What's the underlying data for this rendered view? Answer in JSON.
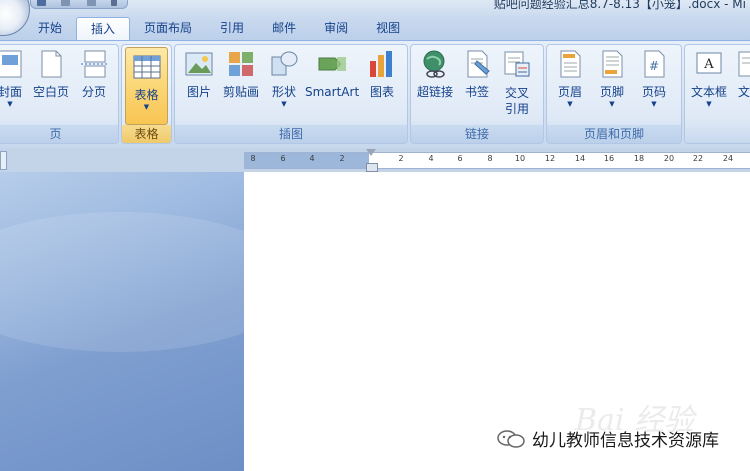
{
  "window": {
    "title": "贴吧问题经验汇总8.7-8.13【小笼】.docx - Mi"
  },
  "tabs": [
    {
      "label": "开始"
    },
    {
      "label": "插入",
      "active": true
    },
    {
      "label": "页面布局"
    },
    {
      "label": "引用"
    },
    {
      "label": "邮件"
    },
    {
      "label": "审阅"
    },
    {
      "label": "视图"
    }
  ],
  "ribbon": {
    "groups": {
      "pages": {
        "label": "页",
        "buttons": {
          "cover": {
            "label": "封面",
            "icon": "cover-page-icon"
          },
          "blank": {
            "label": "空白页",
            "icon": "blank-page-icon"
          },
          "break": {
            "label": "分页",
            "icon": "page-break-icon"
          }
        }
      },
      "tables": {
        "label": "表格",
        "buttons": {
          "table": {
            "label": "表格",
            "icon": "table-icon"
          }
        }
      },
      "illustrations": {
        "label": "插图",
        "buttons": {
          "picture": {
            "label": "图片",
            "icon": "picture-icon"
          },
          "clipart": {
            "label": "剪贴画",
            "icon": "clipart-icon"
          },
          "shapes": {
            "label": "形状",
            "icon": "shapes-icon"
          },
          "smartart": {
            "label": "SmartArt",
            "icon": "smartart-icon"
          },
          "chart": {
            "label": "图表",
            "icon": "chart-icon"
          }
        }
      },
      "links": {
        "label": "链接",
        "buttons": {
          "hyperlink": {
            "label": "超链接",
            "icon": "hyperlink-icon"
          },
          "bookmark": {
            "label": "书签",
            "icon": "bookmark-icon"
          },
          "crossref": {
            "label": "交叉\n引用",
            "line1": "交叉",
            "line2": "引用",
            "icon": "cross-reference-icon"
          }
        }
      },
      "header_footer": {
        "label": "页眉和页脚",
        "buttons": {
          "header": {
            "label": "页眉",
            "icon": "header-icon"
          },
          "footer": {
            "label": "页脚",
            "icon": "footer-icon"
          },
          "pagenum": {
            "label": "页码",
            "icon": "page-number-icon"
          }
        }
      },
      "text": {
        "buttons": {
          "textbox": {
            "label": "文本框",
            "icon": "textbox-icon"
          },
          "docparts": {
            "label": "文档",
            "icon": "document-parts-icon"
          }
        }
      }
    }
  },
  "ruler": {
    "numbers": [
      "8",
      "6",
      "4",
      "2",
      "2",
      "4",
      "6",
      "8",
      "10",
      "12",
      "14",
      "16",
      "18",
      "20",
      "22",
      "24"
    ]
  },
  "watermark": {
    "text": "Bai 经验"
  },
  "footer_brand": {
    "text": "幼儿教师信息技术资源库",
    "icon": "wechat-icon"
  },
  "colors": {
    "ribbon_text": "#15428b",
    "group_label": "#3e6aaa",
    "selected_button": "#fbd87a",
    "workspace": "#7f9fd0"
  }
}
